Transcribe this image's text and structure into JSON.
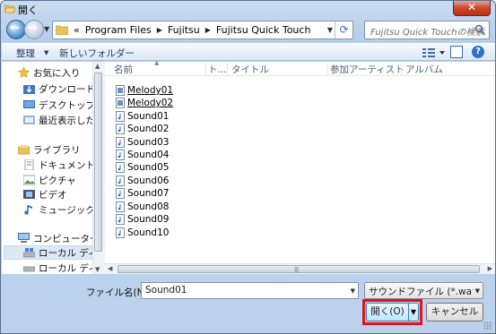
{
  "window": {
    "title": "開く",
    "close_glyph": "✕"
  },
  "address": {
    "overflow": "«",
    "parts": [
      "Program Files",
      "Fujitsu",
      "Fujitsu Quick Touch"
    ]
  },
  "search": {
    "placeholder": "Fujitsu Quick Touchの検索"
  },
  "toolbar": {
    "organize": "整理",
    "new_folder": "新しいフォルダー",
    "help": "?"
  },
  "navpane": {
    "items": [
      {
        "label": "お気に入り",
        "icon": "star-icon"
      },
      {
        "label": "ダウンロード",
        "icon": "download-folder-icon"
      },
      {
        "label": "デスクトップ",
        "icon": "desktop-icon"
      },
      {
        "label": "最近表示した場所",
        "icon": "recent-places-icon"
      },
      {
        "label": "ライブラリ",
        "icon": "libraries-icon"
      },
      {
        "label": "ドキュメント",
        "icon": "documents-icon"
      },
      {
        "label": "ピクチャ",
        "icon": "pictures-icon"
      },
      {
        "label": "ビデオ",
        "icon": "videos-icon"
      },
      {
        "label": "ミュージック",
        "icon": "music-icon"
      },
      {
        "label": "コンピューター",
        "icon": "computer-icon"
      },
      {
        "label": "ローカル ディスク",
        "icon": "local-disk-icon"
      },
      {
        "label": "ローカル ディスク",
        "icon": "local-disk-icon"
      }
    ]
  },
  "columns": {
    "name": "名前",
    "track": "ト...",
    "title": "タイトル",
    "artist": "参加アーティスト",
    "album": "アルバム"
  },
  "files": [
    "Melody01",
    "Melody02",
    "Sound01",
    "Sound02",
    "Sound03",
    "Sound04",
    "Sound05",
    "Sound06",
    "Sound07",
    "Sound08",
    "Sound09",
    "Sound10"
  ],
  "bottom": {
    "filename_label": "ファイル名(N):",
    "filename_value": "Sound01",
    "filetype_value": "サウンドファイル (*.wav;*.mid)",
    "open_label": "開く(O)",
    "cancel_label": "キャンセル"
  },
  "colors": {
    "highlight": "#e8101a",
    "accent": "#3c7fb1"
  }
}
